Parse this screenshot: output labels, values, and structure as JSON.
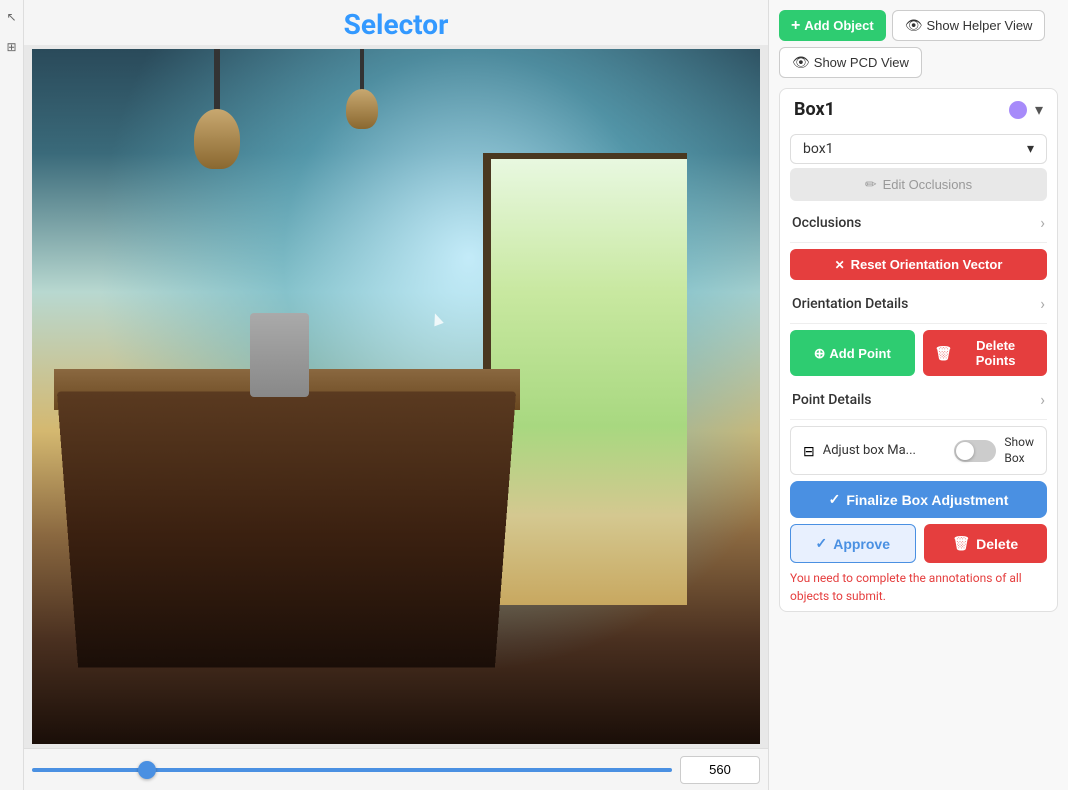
{
  "title": "Selector",
  "header": {
    "add_object_label": "Add Object",
    "show_helper_label": "Show Helper View",
    "show_pcd_label": "Show PCD View"
  },
  "box": {
    "title": "Box1",
    "color": "#a78bfa",
    "dropdown_value": "box1",
    "dropdown_placeholder": "box1",
    "edit_occlusions_label": "Edit Occlusions",
    "occlusions_label": "Occlusions",
    "reset_orientation_label": "Reset Orientation Vector",
    "orientation_details_label": "Orientation Details",
    "add_point_label": "Add Point",
    "delete_points_label": "Delete Points",
    "point_details_label": "Point Details",
    "adjust_box_label": "Adjust box Ma...",
    "show_box_label": "Show\nBox",
    "finalize_label": "Finalize Box Adjustment",
    "approve_label": "Approve",
    "delete_label": "Delete",
    "warning_text": "You need to complete the annotations of all objects to submit."
  },
  "bottom": {
    "frame_value": "560"
  },
  "left_icons": [
    {
      "name": "cursor-icon",
      "symbol": "↖"
    },
    {
      "name": "tool-icon",
      "symbol": "⊞"
    }
  ]
}
